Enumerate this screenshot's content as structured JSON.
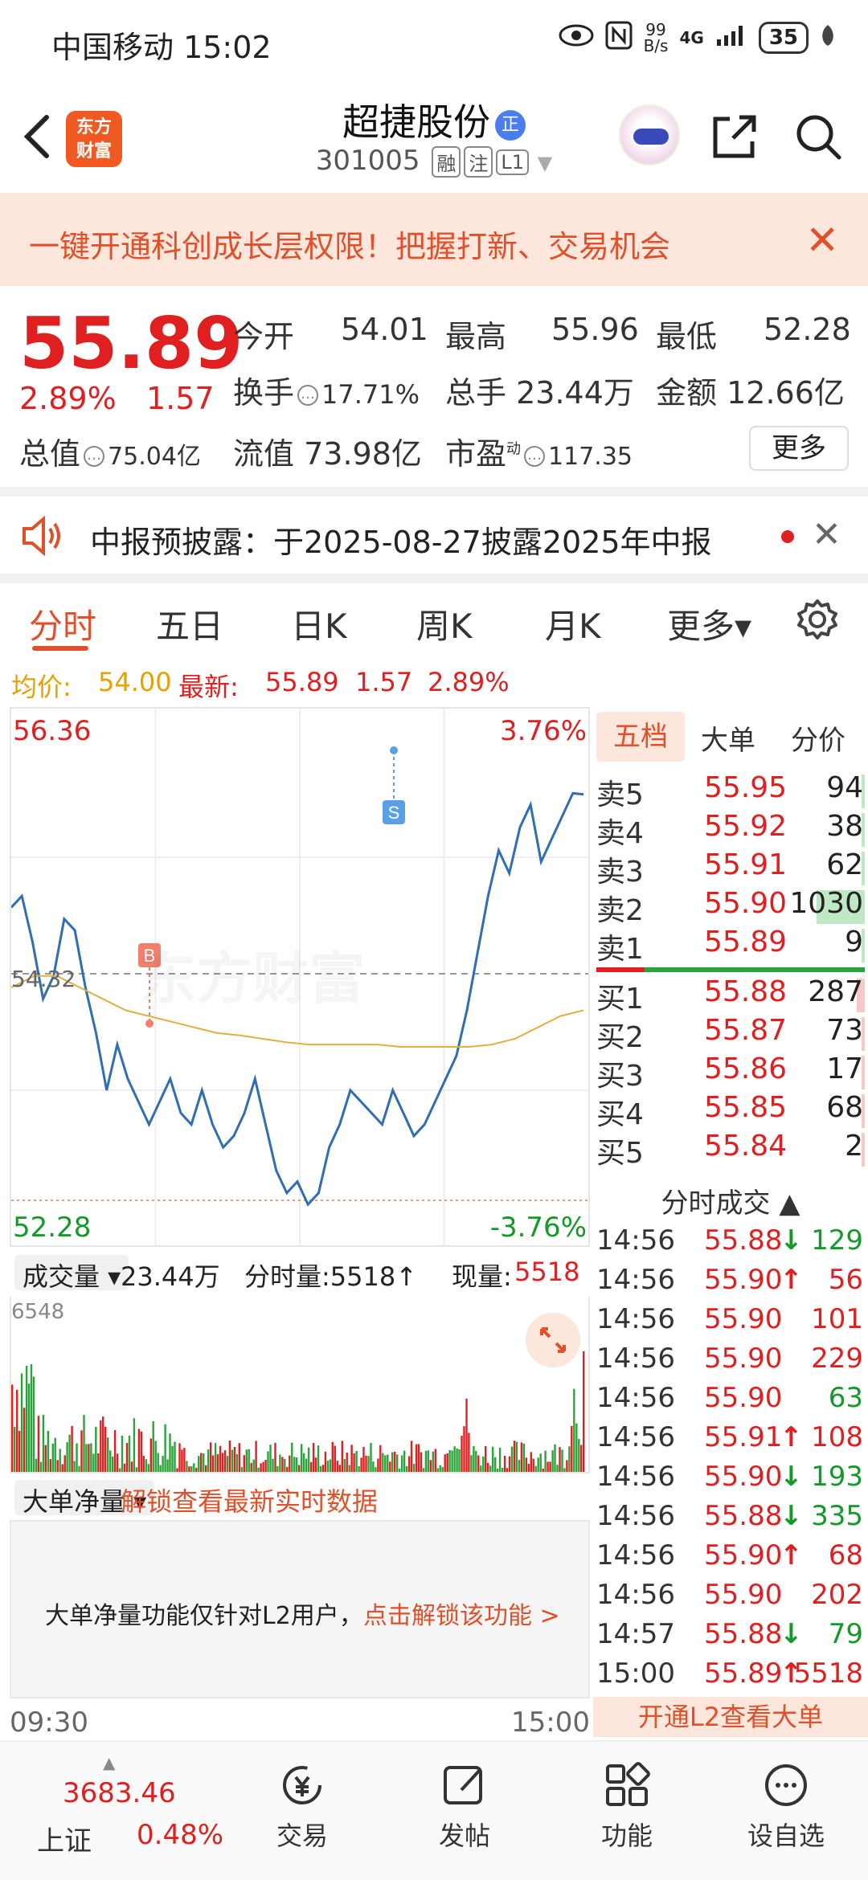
{
  "status_bar": {
    "carrier_time": "中国移动 15:02",
    "net_speed_top": "99",
    "net_speed_bottom": "B/s",
    "signal": "4G",
    "battery": "35"
  },
  "header": {
    "logo_text": "东方\n财富",
    "stock_name": "超捷股份",
    "name_badge": "正",
    "stock_code": "301005",
    "tags": [
      "融",
      "注",
      "L1"
    ]
  },
  "banner": {
    "text": "一键开通科创成长层权限！把握打新、交易机会",
    "close": "✕"
  },
  "quote": {
    "price": "55.89",
    "pct": "2.89%",
    "chg": "1.57",
    "open_label": "今开",
    "open": "54.01",
    "high_label": "最高",
    "high": "55.96",
    "low_label": "最低",
    "low": "52.28",
    "turnover_label": "换手",
    "turnover": "17.71%",
    "volume_label": "总手",
    "volume": "23.44万",
    "amount_label": "金额",
    "amount": "12.66亿",
    "total_val_label": "总值",
    "total_val": "75.04亿",
    "float_label": "流值",
    "float": "73.98亿",
    "pe_label": "市盈",
    "pe_sup": "动",
    "pe": "117.35",
    "more": "更多"
  },
  "notice": {
    "text": "中报预披露：于2025-08-27披露2025年中报",
    "close": "✕"
  },
  "tabs": [
    "分时",
    "五日",
    "日K",
    "周K",
    "月K",
    "更多▾"
  ],
  "summary": {
    "avg_label": "均价:",
    "avg": "54.00",
    "latest_label": "最新:",
    "latest": "55.89",
    "chg": "1.57",
    "pct": "2.89%"
  },
  "chart": {
    "high_label": "56.36",
    "low_label": "52.28",
    "up_pct": "3.76%",
    "down_pct": "-3.76%",
    "base_label": "54.32",
    "watermark": "东方财富",
    "buy_marker": "B",
    "sell_marker": "S"
  },
  "volume": {
    "dropdown": "成交量 ▾",
    "total": "23.44万",
    "tick_label": "分时量:5518↑",
    "now_label": "现量:",
    "now": "5518",
    "max": "6548"
  },
  "bignet": {
    "dropdown": "大单净量 ▾",
    "unlock": "解锁查看最新实时数据",
    "msg": "大单净量功能仅针对L2用户，",
    "link": "点击解锁该功能 >"
  },
  "time_axis": {
    "start": "09:30",
    "end": "15:00"
  },
  "side_tabs": [
    "五档",
    "大单",
    "分价"
  ],
  "asks": [
    {
      "label": "卖5",
      "price": "55.95",
      "vol": "94",
      "bar": 0.04
    },
    {
      "label": "卖4",
      "price": "55.92",
      "vol": "38",
      "bar": 0.02
    },
    {
      "label": "卖3",
      "price": "55.91",
      "vol": "62",
      "bar": 0.03
    },
    {
      "label": "卖2",
      "price": "55.90",
      "vol": "1030",
      "bar": 0.6
    },
    {
      "label": "卖1",
      "price": "55.89",
      "vol": "9",
      "bar": 0.005
    }
  ],
  "bids": [
    {
      "label": "买1",
      "price": "55.88",
      "vol": "287",
      "bar": 0.1
    },
    {
      "label": "买2",
      "price": "55.87",
      "vol": "73",
      "bar": 0.03
    },
    {
      "label": "买3",
      "price": "55.86",
      "vol": "17",
      "bar": 0.01
    },
    {
      "label": "买4",
      "price": "55.85",
      "vol": "68",
      "bar": 0.03
    },
    {
      "label": "买5",
      "price": "55.84",
      "vol": "2",
      "bar": 0.005
    }
  ],
  "ticks_head": "分时成交 ▲",
  "ticks": [
    {
      "t": "14:56",
      "p": "55.88",
      "a": "↓",
      "v": "129",
      "c": "green"
    },
    {
      "t": "14:56",
      "p": "55.90",
      "a": "↑",
      "v": "56",
      "c": "red"
    },
    {
      "t": "14:56",
      "p": "55.90",
      "a": "",
      "v": "101",
      "c": "red"
    },
    {
      "t": "14:56",
      "p": "55.90",
      "a": "",
      "v": "229",
      "c": "red"
    },
    {
      "t": "14:56",
      "p": "55.90",
      "a": "",
      "v": "63",
      "c": "green"
    },
    {
      "t": "14:56",
      "p": "55.91",
      "a": "↑",
      "v": "108",
      "c": "red"
    },
    {
      "t": "14:56",
      "p": "55.90",
      "a": "↓",
      "v": "193",
      "c": "green"
    },
    {
      "t": "14:56",
      "p": "55.88",
      "a": "↓",
      "v": "335",
      "c": "green"
    },
    {
      "t": "14:56",
      "p": "55.90",
      "a": "↑",
      "v": "68",
      "c": "red"
    },
    {
      "t": "14:56",
      "p": "55.90",
      "a": "",
      "v": "202",
      "c": "red"
    },
    {
      "t": "14:57",
      "p": "55.88",
      "a": "↓",
      "v": "79",
      "c": "green"
    },
    {
      "t": "15:00",
      "p": "55.89",
      "a": "↑",
      "v": "5518",
      "c": "red"
    }
  ],
  "l2_bar": "开通L2查看大单",
  "bottom_nav": {
    "index_val": "3683.46",
    "index_name": "上证",
    "index_pct": "0.48%",
    "items": [
      "交易",
      "发帖",
      "功能",
      "设自选"
    ]
  },
  "chart_data": {
    "type": "line",
    "title": "",
    "ylim": [
      52.28,
      56.36
    ],
    "series": [
      {
        "values": [
          54.9,
          55.0,
          54.6,
          54.1,
          54.3,
          54.8,
          54.7,
          54.2,
          53.8,
          53.3,
          53.7,
          53.4,
          53.2,
          53.0,
          53.2,
          53.4,
          53.1,
          53.0,
          53.3,
          53.0,
          52.8,
          52.9,
          53.1,
          53.4,
          53.0,
          52.6,
          52.4,
          52.5,
          52.3,
          52.4,
          52.8,
          53.0,
          53.3,
          53.2,
          53.1,
          53.0,
          53.3,
          53.1,
          52.9,
          53.0,
          53.2,
          53.4,
          53.6,
          54.0,
          54.5,
          55.0,
          55.4,
          55.2,
          55.6,
          55.8,
          55.3,
          55.5,
          55.7,
          55.9,
          55.89
        ]
      },
      {
        "values": [
          54.2,
          54.3,
          54.3,
          54.2,
          54.1,
          54.0,
          53.95,
          53.9,
          53.85,
          53.8,
          53.78,
          53.75,
          53.72,
          53.7,
          53.7,
          53.7,
          53.7,
          53.68,
          53.68,
          53.68,
          53.68,
          53.7,
          53.75,
          53.85,
          53.95,
          54.0
        ]
      }
    ]
  }
}
